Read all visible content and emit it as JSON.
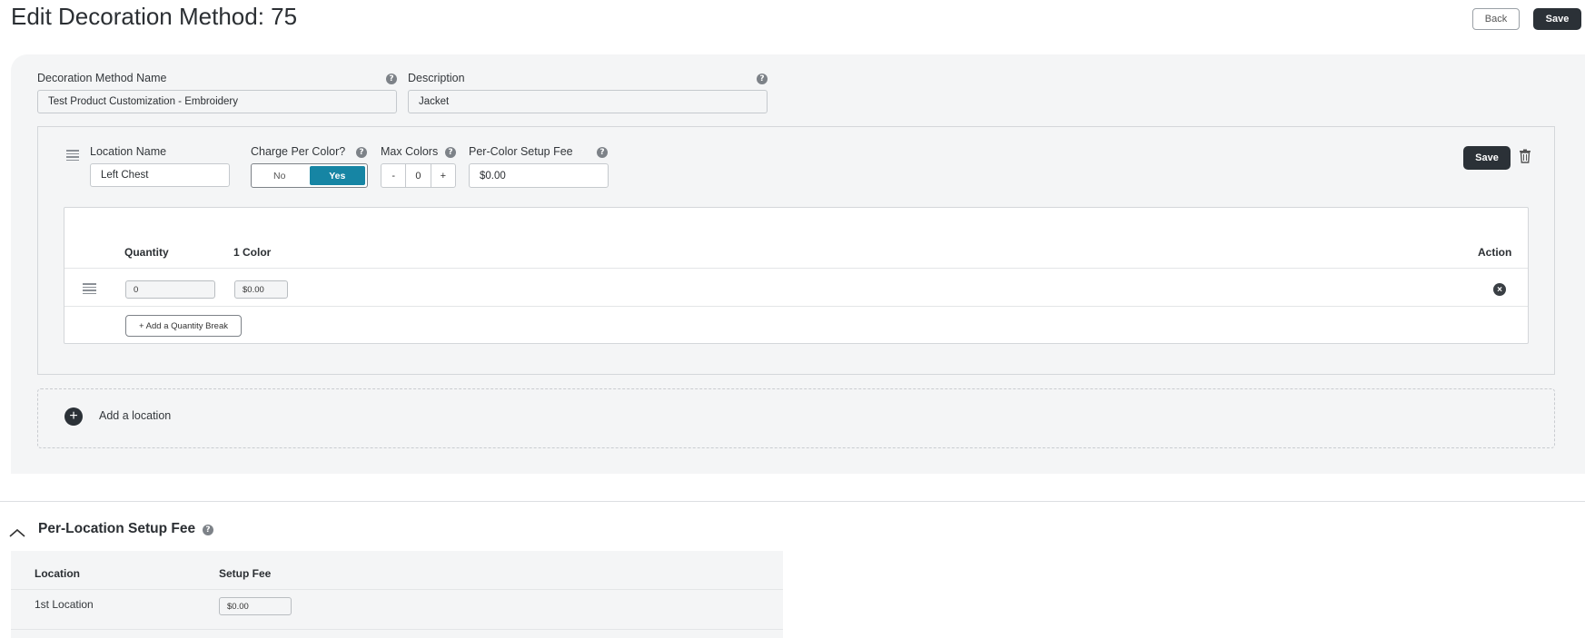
{
  "page": {
    "title": "Edit Decoration Method: 75",
    "back_label": "Back",
    "save_label": "Save"
  },
  "form": {
    "name_label": "Decoration Method Name",
    "name_value": "Test Product Customization - Embroidery",
    "description_label": "Description",
    "description_value": "Jacket",
    "help_glyph": "?"
  },
  "location": {
    "name_label": "Location Name",
    "name_value": "Left Chest",
    "charge_label": "Charge Per Color?",
    "toggle_no": "No",
    "toggle_yes": "Yes",
    "toggle_selected": "Yes",
    "max_colors_label": "Max Colors",
    "minus": "-",
    "max_colors_value": "0",
    "plus": "+",
    "setup_fee_label": "Per-Color Setup Fee",
    "setup_fee_value": "$0.00",
    "save_label": "Save",
    "table": {
      "headers": {
        "quantity": "Quantity",
        "color1": "1 Color",
        "action": "Action"
      },
      "rows": [
        {
          "quantity": "0",
          "price": "$0.00"
        }
      ],
      "add_break_label": "+ Add a Quantity Break"
    }
  },
  "add_location": {
    "label": "Add a location",
    "plus": "+"
  },
  "per_location": {
    "title": "Per-Location Setup Fee",
    "headers": {
      "location": "Location",
      "fee": "Setup Fee"
    },
    "rows": [
      {
        "location": "1st Location",
        "fee": "$0.00"
      }
    ]
  },
  "colors": {
    "accent": "#1685a4",
    "dark": "#2b3137",
    "panel": "#f4f5f6"
  }
}
